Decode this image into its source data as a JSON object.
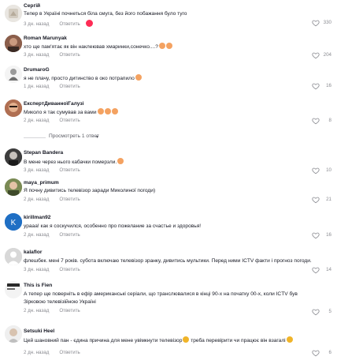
{
  "actions": {
    "reply_label": "Ответить"
  },
  "colors": {
    "meta": "#8a8b91",
    "text": "#161823",
    "emoji": "#f4a261"
  },
  "view_more": {
    "label": "Просмотреть 1 ответ",
    "icon": "chevron-down-icon"
  },
  "comments": [
    {
      "author": "Сергій",
      "text": "Тепер в Україні почнеться біла смуга, без його побажання було туго",
      "emoji": "",
      "time": "3 дн. назад",
      "likes": "330",
      "reaction": true
    },
    {
      "author": "Roman Marunyak",
      "text": "хто ще пам'ятає як він наклеював хмаринки,сонечко....?",
      "emoji": "😢😢",
      "time": "3 дн. назад",
      "likes": "204",
      "reaction": false
    },
    {
      "author": "DrumaroG",
      "text": "я не плачу, просто дитинство в око потрапило",
      "emoji": "😞",
      "time": "1 дн. назад",
      "likes": "16",
      "reaction": false
    },
    {
      "author": "ЕкспертДиванноїГалузі",
      "text": "Миколо я так сумував за вами",
      "emoji": "😢😢😢",
      "time": "2 дн. назад",
      "likes": "8",
      "reaction": false
    },
    {
      "author": "Stepan Bandera",
      "text": "В мене через нього кабачки померзли.",
      "emoji": "😂",
      "time": "3 дн. назад",
      "likes": "10",
      "reaction": false
    },
    {
      "author": "maya_primum",
      "text": "Я почну дивитись телевізор заради Миколиної погоди)",
      "emoji": "",
      "time": "2 дн. назад",
      "likes": "21",
      "reaction": false
    },
    {
      "author": "kirillman92",
      "text": "урааа! как я соскучился, особенно про пожелание за счастье и здоровья!",
      "emoji": "",
      "time": "2 дн. назад",
      "likes": "16",
      "reaction": false
    },
    {
      "author": "kalaflor",
      "text": "флешбек. мені 7 років. субота включаю телевізор зранку, дивитись мультики. Перед ними ICTV факти і прогноз погоди.",
      "emoji": "",
      "time": "3 дн. назад",
      "likes": "14",
      "reaction": false
    },
    {
      "author": "This is Fien",
      "text": "А тепер ще поверніть в ефір американські серіали, що транслювалися в кінці 90-х на початку 00-х, коли ICTV був Зірковою телевізійною Україні",
      "emoji": "",
      "time": "2 дн. назад",
      "likes": "5",
      "reaction": false
    },
    {
      "author": "Setsuki Heel",
      "text": "Цей шановний пан - єдина причина для мене увімкнути телевізор",
      "text2": " треба перевірити чи працює він взагалі",
      "emoji": "😵",
      "emoji2": "😜",
      "time": "2 дн. назад",
      "likes": "6",
      "reaction": false
    }
  ]
}
